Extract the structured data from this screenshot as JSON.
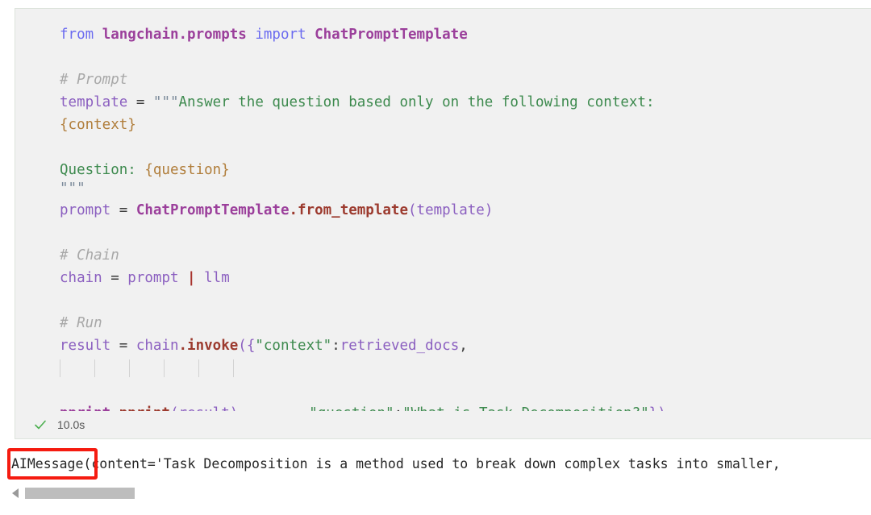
{
  "cell": {
    "language": "python",
    "background": "#f1f1f1",
    "border_color": "#dde3dc",
    "lines": {
      "l1_from": "from",
      "l1_module": " langchain.prompts ",
      "l1_import": "import",
      "l1_class": " ChatPromptTemplate",
      "l3_comment": "# Prompt",
      "l4_var": "template",
      "l4_op": " = ",
      "l4_quote": "\"\"\"",
      "l4_str": "Answer the question based only on the following context:",
      "l5_fmt": "{context}",
      "l7_str": "Question: ",
      "l7_fmt": "{question}",
      "l8_quote": "\"\"\"",
      "l9_var": "prompt",
      "l9_op": " = ",
      "l9_class": "ChatPromptTemplate",
      "l9_fn": ".from_template",
      "l9_open": "(",
      "l9_arg": "template",
      "l9_close": ")",
      "l11_comment": "# Chain",
      "l12_var": "chain",
      "l12_op": " = ",
      "l12_var2": "prompt",
      "l12_pipe": " | ",
      "l12_var3": "llm",
      "l14_comment": "# Run",
      "l15_var": "result",
      "l15_op": " = ",
      "l15_obj": "chain",
      "l15_fn": ".invoke",
      "l15_open": "({",
      "l15_key": "\"context\"",
      "l15_colon": ":",
      "l15_val": "retrieved_docs",
      "l15_comma": ",",
      "l16_key": "\"question\"",
      "l16_colon": ":",
      "l16_val": "\"What is Task Decomposition?\"",
      "l16_close": "})",
      "l18_obj": "pprint",
      "l18_fn": ".pprint",
      "l18_open": "(",
      "l18_arg": "result",
      "l18_close": ")"
    }
  },
  "status": {
    "icon": "check-icon",
    "icon_color": "#4caf50",
    "elapsed": "10.0s"
  },
  "output": {
    "text": "AIMessage(content='Task Decomposition is a method used to break down complex tasks into smaller,",
    "highlight": {
      "label": "AIMessage",
      "color": "#f51b10"
    }
  },
  "scrollbar": {
    "orientation": "horizontal",
    "left_arrow": "triangle-left-icon",
    "thumb_color": "#bdbdbd"
  }
}
